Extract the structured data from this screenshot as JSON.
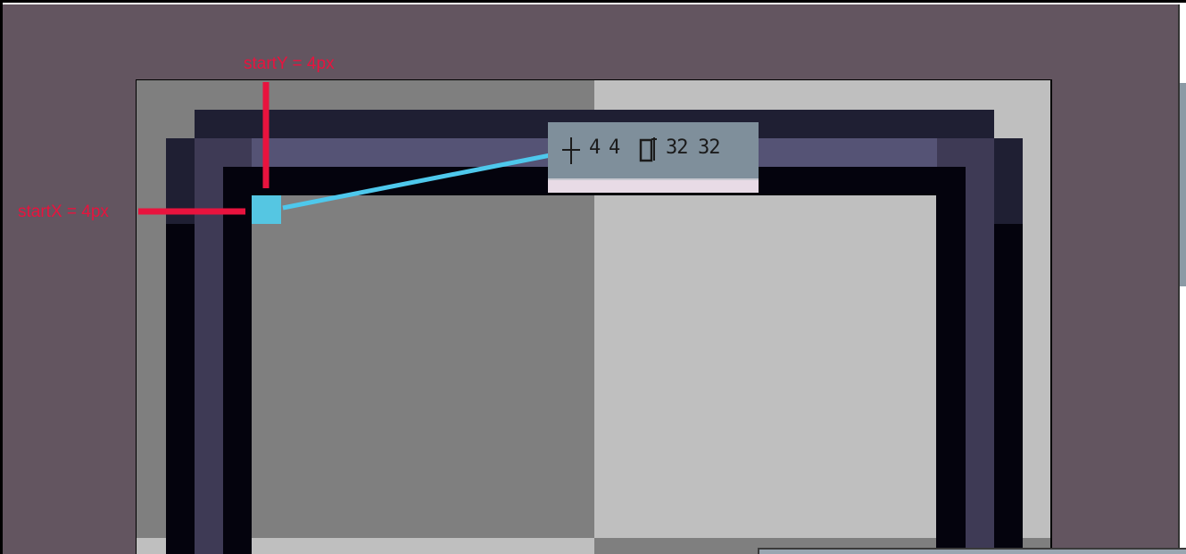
{
  "annotations": {
    "start_y_label": "startY = 4px",
    "start_x_label": "startX = 4px",
    "start_x_value": 4,
    "start_y_value": 4
  },
  "coord_readout": {
    "cursor_icon": "crosshair-icon",
    "x": "4",
    "y": "4",
    "size_icon": "selection-size-icon",
    "width": "32",
    "height": "32"
  },
  "colors": {
    "annotation_red": "#e8133e",
    "connector_blue": "#4ec8ec",
    "outer_background": "#635560",
    "readout_background": "#7f8f9b"
  }
}
